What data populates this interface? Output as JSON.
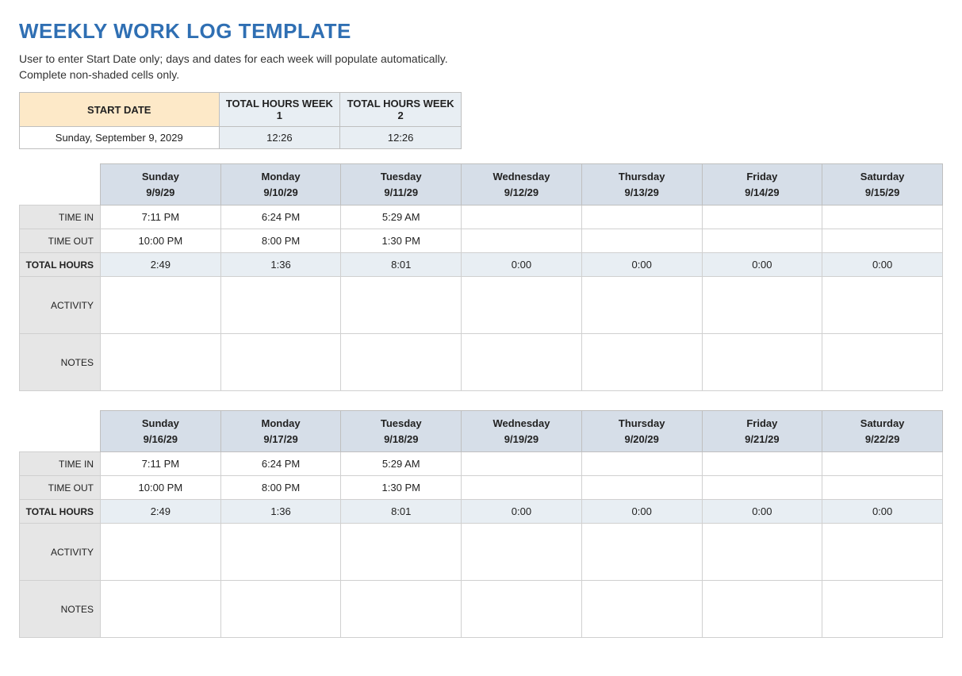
{
  "title": "WEEKLY WORK LOG TEMPLATE",
  "instructions_line1": "User to enter Start Date only; days and dates for each week will populate automatically.",
  "instructions_line2": "Complete non-shaded cells only.",
  "summary": {
    "start_date_label": "START DATE",
    "total_week1_label": "TOTAL HOURS WEEK 1",
    "total_week2_label": "TOTAL HOURS WEEK 2",
    "start_date_value": "Sunday, September 9, 2029",
    "total_week1_value": "12:26",
    "total_week2_value": "12:26"
  },
  "row_labels": {
    "time_in": "TIME IN",
    "time_out": "TIME OUT",
    "total_hours": "TOTAL HOURS",
    "activity": "ACTIVITY",
    "notes": "NOTES"
  },
  "weeks": [
    {
      "days": [
        {
          "dow": "Sunday",
          "date": "9/9/29",
          "time_in": "7:11 PM",
          "time_out": "10:00 PM",
          "total": "2:49",
          "activity": "",
          "notes": ""
        },
        {
          "dow": "Monday",
          "date": "9/10/29",
          "time_in": "6:24 PM",
          "time_out": "8:00 PM",
          "total": "1:36",
          "activity": "",
          "notes": ""
        },
        {
          "dow": "Tuesday",
          "date": "9/11/29",
          "time_in": "5:29 AM",
          "time_out": "1:30 PM",
          "total": "8:01",
          "activity": "",
          "notes": ""
        },
        {
          "dow": "Wednesday",
          "date": "9/12/29",
          "time_in": "",
          "time_out": "",
          "total": "0:00",
          "activity": "",
          "notes": ""
        },
        {
          "dow": "Thursday",
          "date": "9/13/29",
          "time_in": "",
          "time_out": "",
          "total": "0:00",
          "activity": "",
          "notes": ""
        },
        {
          "dow": "Friday",
          "date": "9/14/29",
          "time_in": "",
          "time_out": "",
          "total": "0:00",
          "activity": "",
          "notes": ""
        },
        {
          "dow": "Saturday",
          "date": "9/15/29",
          "time_in": "",
          "time_out": "",
          "total": "0:00",
          "activity": "",
          "notes": ""
        }
      ]
    },
    {
      "days": [
        {
          "dow": "Sunday",
          "date": "9/16/29",
          "time_in": "7:11 PM",
          "time_out": "10:00 PM",
          "total": "2:49",
          "activity": "",
          "notes": ""
        },
        {
          "dow": "Monday",
          "date": "9/17/29",
          "time_in": "6:24 PM",
          "time_out": "8:00 PM",
          "total": "1:36",
          "activity": "",
          "notes": ""
        },
        {
          "dow": "Tuesday",
          "date": "9/18/29",
          "time_in": "5:29 AM",
          "time_out": "1:30 PM",
          "total": "8:01",
          "activity": "",
          "notes": ""
        },
        {
          "dow": "Wednesday",
          "date": "9/19/29",
          "time_in": "",
          "time_out": "",
          "total": "0:00",
          "activity": "",
          "notes": ""
        },
        {
          "dow": "Thursday",
          "date": "9/20/29",
          "time_in": "",
          "time_out": "",
          "total": "0:00",
          "activity": "",
          "notes": ""
        },
        {
          "dow": "Friday",
          "date": "9/21/29",
          "time_in": "",
          "time_out": "",
          "total": "0:00",
          "activity": "",
          "notes": ""
        },
        {
          "dow": "Saturday",
          "date": "9/22/29",
          "time_in": "",
          "time_out": "",
          "total": "0:00",
          "activity": "",
          "notes": ""
        }
      ]
    }
  ]
}
